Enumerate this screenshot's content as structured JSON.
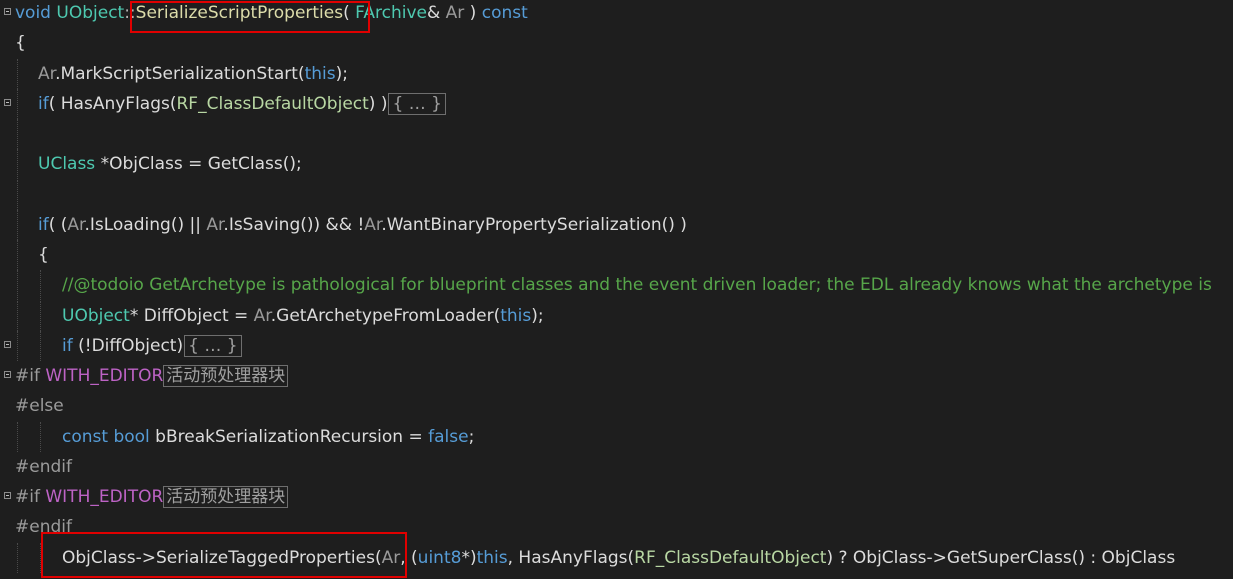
{
  "editor": {
    "lines": [
      {
        "fold": true,
        "indent": 0,
        "tokens": [
          {
            "t": "void ",
            "c": "kw"
          },
          {
            "t": "UObject",
            "c": "ty"
          },
          {
            "t": "::",
            "c": "op"
          },
          {
            "t": "SerializeScriptProperties",
            "c": "fn"
          },
          {
            "t": "( ",
            "c": "id"
          },
          {
            "t": "FArchive",
            "c": "ty"
          },
          {
            "t": "& ",
            "c": "id"
          },
          {
            "t": "Ar",
            "c": "prm"
          },
          {
            "t": " ) ",
            "c": "id"
          },
          {
            "t": "const",
            "c": "kw"
          }
        ]
      },
      {
        "fold": false,
        "indent": 0,
        "tokens": [
          {
            "t": "{",
            "c": "id"
          }
        ]
      },
      {
        "fold": false,
        "indent": 1,
        "tokens": [
          {
            "t": "Ar",
            "c": "prm"
          },
          {
            "t": ".",
            "c": "id"
          },
          {
            "t": "MarkScriptSerializationStart",
            "c": "fnw"
          },
          {
            "t": "(",
            "c": "id"
          },
          {
            "t": "this",
            "c": "kw"
          },
          {
            "t": ");",
            "c": "id"
          }
        ]
      },
      {
        "fold": true,
        "indent": 1,
        "tokens": [
          {
            "t": "if",
            "c": "kw"
          },
          {
            "t": "( ",
            "c": "id"
          },
          {
            "t": "HasAnyFlags",
            "c": "fnw"
          },
          {
            "t": "(",
            "c": "id"
          },
          {
            "t": "RF_ClassDefaultObject",
            "c": "en"
          },
          {
            "t": ") )",
            "c": "id"
          },
          {
            "t": "{ … }",
            "c": "collapsed"
          }
        ]
      },
      {
        "fold": false,
        "indent": 1,
        "tokens": []
      },
      {
        "fold": false,
        "indent": 1,
        "tokens": [
          {
            "t": "UClass",
            "c": "ty"
          },
          {
            "t": " *ObjClass = ",
            "c": "id"
          },
          {
            "t": "GetClass",
            "c": "fnw"
          },
          {
            "t": "();",
            "c": "id"
          }
        ]
      },
      {
        "fold": false,
        "indent": 1,
        "tokens": []
      },
      {
        "fold": false,
        "indent": 1,
        "tokens": [
          {
            "t": "if",
            "c": "kw"
          },
          {
            "t": "( (",
            "c": "id"
          },
          {
            "t": "Ar",
            "c": "prm"
          },
          {
            "t": ".",
            "c": "id"
          },
          {
            "t": "IsLoading",
            "c": "fnw"
          },
          {
            "t": "() || ",
            "c": "id"
          },
          {
            "t": "Ar",
            "c": "prm"
          },
          {
            "t": ".",
            "c": "id"
          },
          {
            "t": "IsSaving",
            "c": "fnw"
          },
          {
            "t": "()) && !",
            "c": "id"
          },
          {
            "t": "Ar",
            "c": "prm"
          },
          {
            "t": ".",
            "c": "id"
          },
          {
            "t": "WantBinaryPropertySerialization",
            "c": "fnw"
          },
          {
            "t": "() )",
            "c": "id"
          }
        ]
      },
      {
        "fold": false,
        "indent": 1,
        "tokens": [
          {
            "t": "{",
            "c": "id"
          }
        ]
      },
      {
        "fold": false,
        "indent": 2,
        "tokens": [
          {
            "t": "//@todoio GetArchetype is pathological for blueprint classes and the event driven loader; the EDL already knows what the archetype is",
            "c": "cm"
          }
        ]
      },
      {
        "fold": false,
        "indent": 2,
        "tokens": [
          {
            "t": "UObject",
            "c": "ty"
          },
          {
            "t": "* DiffObject = ",
            "c": "id"
          },
          {
            "t": "Ar",
            "c": "prm"
          },
          {
            "t": ".",
            "c": "id"
          },
          {
            "t": "GetArchetypeFromLoader",
            "c": "fnw"
          },
          {
            "t": "(",
            "c": "id"
          },
          {
            "t": "this",
            "c": "kw"
          },
          {
            "t": ");",
            "c": "id"
          }
        ]
      },
      {
        "fold": true,
        "indent": 2,
        "tokens": [
          {
            "t": "if",
            "c": "kw"
          },
          {
            "t": " (!DiffObject)",
            "c": "id"
          },
          {
            "t": "{ … }",
            "c": "collapsed"
          }
        ]
      },
      {
        "fold": true,
        "indent": 0,
        "tokens": [
          {
            "t": "#if",
            "c": "pp"
          },
          {
            "t": " ",
            "c": "id"
          },
          {
            "t": "WITH_EDITOR",
            "c": "mac"
          },
          {
            "t": "活动预处理器块",
            "c": "tag"
          }
        ]
      },
      {
        "fold": false,
        "indent": 0,
        "tokens": [
          {
            "t": "#else",
            "c": "pp"
          }
        ]
      },
      {
        "fold": false,
        "indent": 2,
        "tokens": [
          {
            "t": "const",
            "c": "kw"
          },
          {
            "t": " ",
            "c": "id"
          },
          {
            "t": "bool",
            "c": "kw"
          },
          {
            "t": " bBreakSerializationRecursion = ",
            "c": "id"
          },
          {
            "t": "false",
            "c": "kw"
          },
          {
            "t": ";",
            "c": "id"
          }
        ]
      },
      {
        "fold": false,
        "indent": 0,
        "tokens": [
          {
            "t": "#endif",
            "c": "pp"
          }
        ]
      },
      {
        "fold": true,
        "indent": 0,
        "tokens": [
          {
            "t": "#if",
            "c": "pp"
          },
          {
            "t": " ",
            "c": "id"
          },
          {
            "t": "WITH_EDITOR",
            "c": "mac"
          },
          {
            "t": "活动预处理器块",
            "c": "tag"
          }
        ]
      },
      {
        "fold": false,
        "indent": 0,
        "tokens": [
          {
            "t": "#endif",
            "c": "pp"
          }
        ]
      },
      {
        "fold": false,
        "indent": 2,
        "tokens": [
          {
            "t": "ObjClass->",
            "c": "id"
          },
          {
            "t": "SerializeTaggedProperties",
            "c": "fnw"
          },
          {
            "t": "(",
            "c": "id"
          },
          {
            "t": "Ar",
            "c": "prm"
          },
          {
            "t": ", (",
            "c": "id"
          },
          {
            "t": "uint8",
            "c": "kw"
          },
          {
            "t": "*)",
            "c": "id"
          },
          {
            "t": "this",
            "c": "kw"
          },
          {
            "t": ", ",
            "c": "id"
          },
          {
            "t": "HasAnyFlags",
            "c": "fnw"
          },
          {
            "t": "(",
            "c": "id"
          },
          {
            "t": "RF_ClassDefaultObject",
            "c": "en"
          },
          {
            "t": ") ? ObjClass->",
            "c": "id"
          },
          {
            "t": "GetSuperClass",
            "c": "fnw"
          },
          {
            "t": "() : ObjClass",
            "c": "id"
          }
        ]
      }
    ]
  },
  "highlights": [
    {
      "label": "SerializeScriptProperties"
    },
    {
      "label": "SerializeTaggedProperties"
    }
  ]
}
